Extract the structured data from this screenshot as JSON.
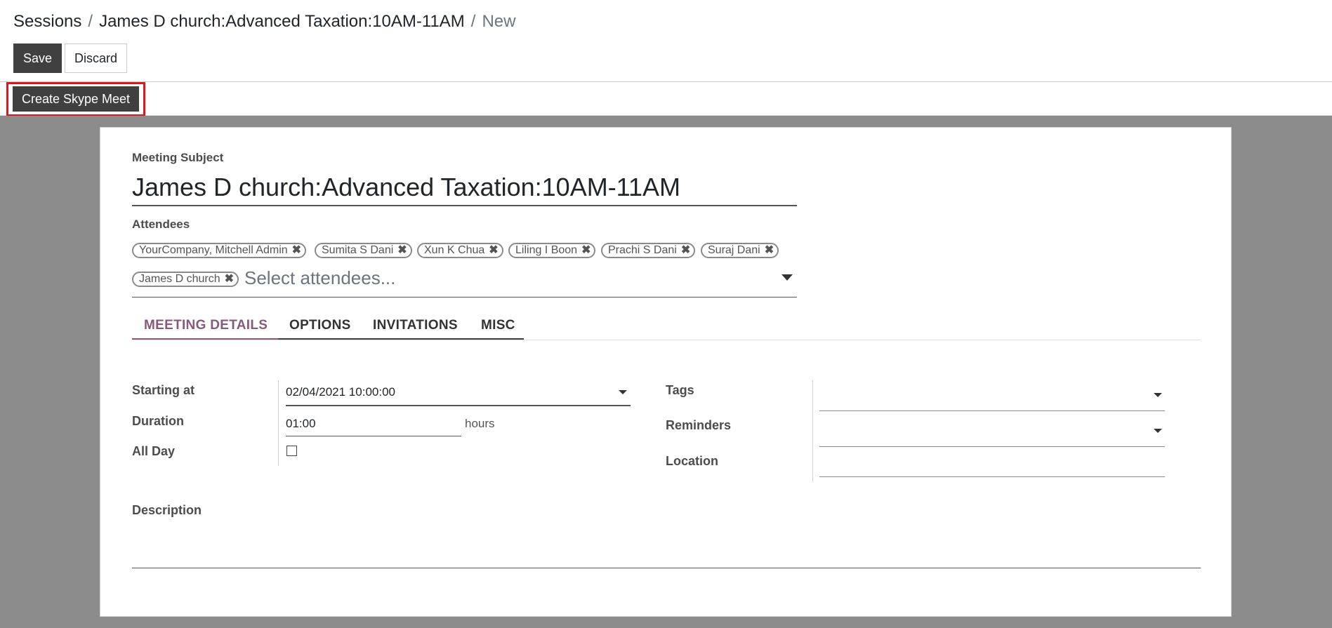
{
  "breadcrumb": {
    "root": "Sessions",
    "parent": "James D church:Advanced Taxation:10AM-11AM",
    "current": "New",
    "separator": "/"
  },
  "toolbar": {
    "save_label": "Save",
    "discard_label": "Discard"
  },
  "header": {
    "create_skype_label": "Create Skype Meet"
  },
  "form": {
    "subject_label": "Meeting Subject",
    "subject_value": "James D church:Advanced Taxation:10AM-11AM",
    "attendees_label": "Attendees",
    "attendees": [
      "YourCompany, Mitchell Admin",
      "Sumita S Dani",
      "Xun K Chua",
      "Liling I Boon",
      "Prachi S Dani",
      "Suraj Dani",
      "James D church"
    ],
    "attendees_placeholder": "Select attendees...",
    "tabs": [
      {
        "label": "MEETING DETAILS",
        "active": true
      },
      {
        "label": "OPTIONS",
        "active": false
      },
      {
        "label": "INVITATIONS",
        "active": false
      },
      {
        "label": "MISC",
        "active": false
      }
    ],
    "starting_at_label": "Starting at",
    "starting_at_value": "02/04/2021 10:00:00",
    "duration_label": "Duration",
    "duration_value": "01:00",
    "duration_unit": "hours",
    "all_day_label": "All Day",
    "tags_label": "Tags",
    "reminders_label": "Reminders",
    "location_label": "Location",
    "description_label": "Description"
  },
  "colors": {
    "primary": "#404040",
    "accent": "#875a7b",
    "highlight": "#e0161e",
    "background": "#8c8c8c"
  }
}
